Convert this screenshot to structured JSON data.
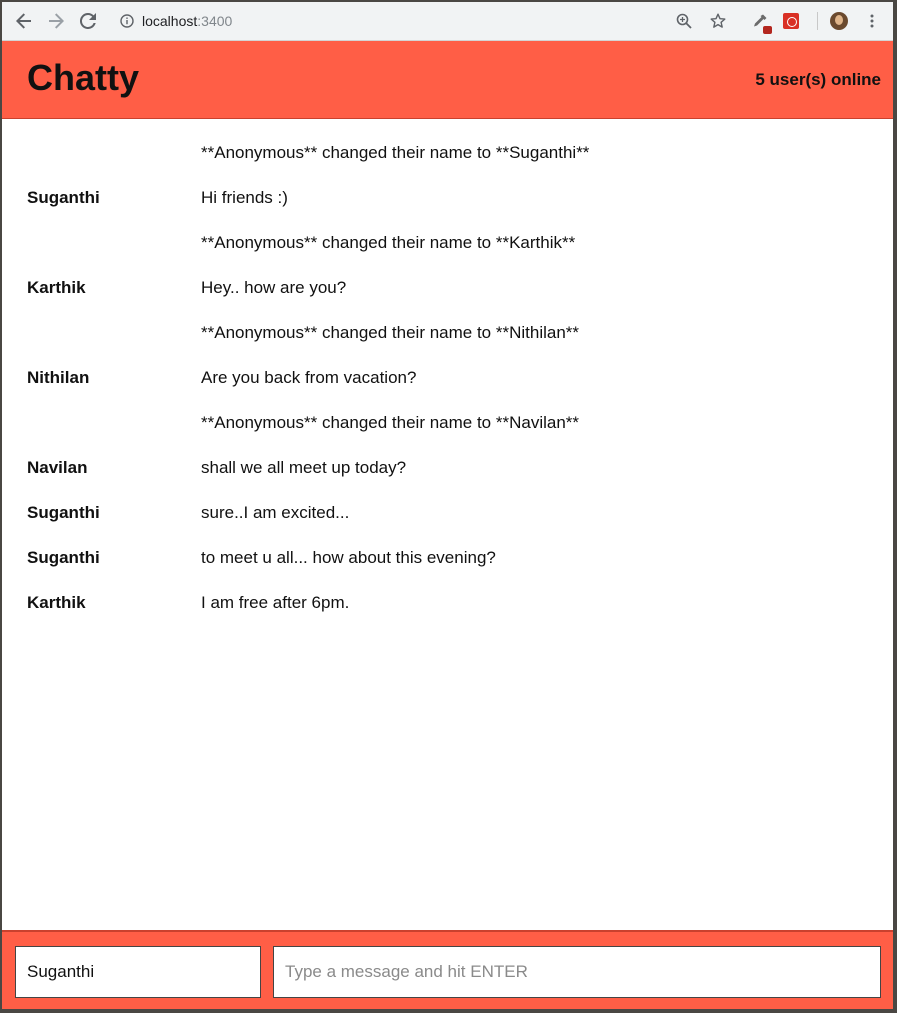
{
  "browser": {
    "url_host": "localhost",
    "url_port": ":3400",
    "icons": [
      "back-icon",
      "forward-icon",
      "reload-icon",
      "info-icon",
      "zoom-icon",
      "star-icon",
      "eyedropper-extension-icon",
      "red-extension-icon",
      "profile-avatar",
      "menu-icon"
    ]
  },
  "app": {
    "title": "Chatty",
    "online_count": "5 user(s) online",
    "accent_color": "#ff5e46"
  },
  "messages": [
    {
      "user": "",
      "text": "**Anonymous** changed their name to **Suganthi**",
      "type": "system"
    },
    {
      "user": "Suganthi",
      "text": "Hi friends :)",
      "type": "chat"
    },
    {
      "user": "",
      "text": "**Anonymous** changed their name to **Karthik**",
      "type": "system"
    },
    {
      "user": "Karthik",
      "text": "Hey.. how are you?",
      "type": "chat"
    },
    {
      "user": "",
      "text": "**Anonymous** changed their name to **Nithilan**",
      "type": "system"
    },
    {
      "user": "Nithilan",
      "text": "Are you back from vacation?",
      "type": "chat"
    },
    {
      "user": "",
      "text": "**Anonymous** changed their name to **Navilan**",
      "type": "system"
    },
    {
      "user": "Navilan",
      "text": "shall we all meet up today?",
      "type": "chat"
    },
    {
      "user": "Suganthi",
      "text": "sure..I am excited...",
      "type": "chat"
    },
    {
      "user": "Suganthi",
      "text": "to meet u all... how about this evening?",
      "type": "chat"
    },
    {
      "user": "Karthik",
      "text": "I am free after 6pm.",
      "type": "chat"
    }
  ],
  "composer": {
    "username_value": "Suganthi",
    "message_placeholder": "Type a message and hit ENTER",
    "message_value": ""
  }
}
